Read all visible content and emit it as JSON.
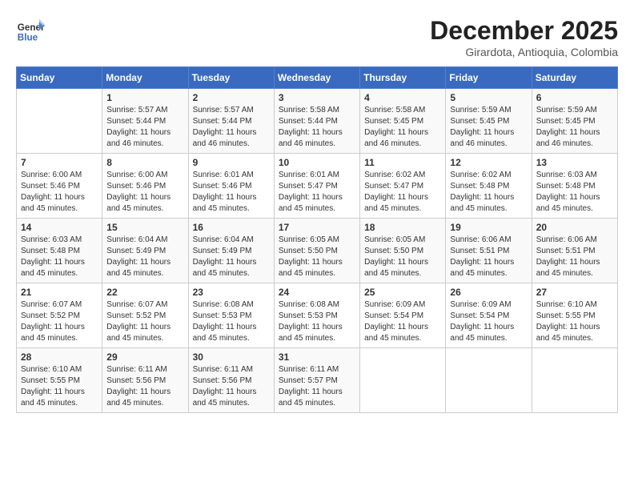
{
  "header": {
    "logo_line1": "General",
    "logo_line2": "Blue",
    "month": "December 2025",
    "location": "Girardota, Antioquia, Colombia"
  },
  "days_of_week": [
    "Sunday",
    "Monday",
    "Tuesday",
    "Wednesday",
    "Thursday",
    "Friday",
    "Saturday"
  ],
  "weeks": [
    [
      {
        "day": "",
        "sunrise": "",
        "sunset": "",
        "daylight": ""
      },
      {
        "day": "1",
        "sunrise": "Sunrise: 5:57 AM",
        "sunset": "Sunset: 5:44 PM",
        "daylight": "Daylight: 11 hours and 46 minutes."
      },
      {
        "day": "2",
        "sunrise": "Sunrise: 5:57 AM",
        "sunset": "Sunset: 5:44 PM",
        "daylight": "Daylight: 11 hours and 46 minutes."
      },
      {
        "day": "3",
        "sunrise": "Sunrise: 5:58 AM",
        "sunset": "Sunset: 5:44 PM",
        "daylight": "Daylight: 11 hours and 46 minutes."
      },
      {
        "day": "4",
        "sunrise": "Sunrise: 5:58 AM",
        "sunset": "Sunset: 5:45 PM",
        "daylight": "Daylight: 11 hours and 46 minutes."
      },
      {
        "day": "5",
        "sunrise": "Sunrise: 5:59 AM",
        "sunset": "Sunset: 5:45 PM",
        "daylight": "Daylight: 11 hours and 46 minutes."
      },
      {
        "day": "6",
        "sunrise": "Sunrise: 5:59 AM",
        "sunset": "Sunset: 5:45 PM",
        "daylight": "Daylight: 11 hours and 46 minutes."
      }
    ],
    [
      {
        "day": "7",
        "sunrise": "Sunrise: 6:00 AM",
        "sunset": "Sunset: 5:46 PM",
        "daylight": "Daylight: 11 hours and 45 minutes."
      },
      {
        "day": "8",
        "sunrise": "Sunrise: 6:00 AM",
        "sunset": "Sunset: 5:46 PM",
        "daylight": "Daylight: 11 hours and 45 minutes."
      },
      {
        "day": "9",
        "sunrise": "Sunrise: 6:01 AM",
        "sunset": "Sunset: 5:46 PM",
        "daylight": "Daylight: 11 hours and 45 minutes."
      },
      {
        "day": "10",
        "sunrise": "Sunrise: 6:01 AM",
        "sunset": "Sunset: 5:47 PM",
        "daylight": "Daylight: 11 hours and 45 minutes."
      },
      {
        "day": "11",
        "sunrise": "Sunrise: 6:02 AM",
        "sunset": "Sunset: 5:47 PM",
        "daylight": "Daylight: 11 hours and 45 minutes."
      },
      {
        "day": "12",
        "sunrise": "Sunrise: 6:02 AM",
        "sunset": "Sunset: 5:48 PM",
        "daylight": "Daylight: 11 hours and 45 minutes."
      },
      {
        "day": "13",
        "sunrise": "Sunrise: 6:03 AM",
        "sunset": "Sunset: 5:48 PM",
        "daylight": "Daylight: 11 hours and 45 minutes."
      }
    ],
    [
      {
        "day": "14",
        "sunrise": "Sunrise: 6:03 AM",
        "sunset": "Sunset: 5:48 PM",
        "daylight": "Daylight: 11 hours and 45 minutes."
      },
      {
        "day": "15",
        "sunrise": "Sunrise: 6:04 AM",
        "sunset": "Sunset: 5:49 PM",
        "daylight": "Daylight: 11 hours and 45 minutes."
      },
      {
        "day": "16",
        "sunrise": "Sunrise: 6:04 AM",
        "sunset": "Sunset: 5:49 PM",
        "daylight": "Daylight: 11 hours and 45 minutes."
      },
      {
        "day": "17",
        "sunrise": "Sunrise: 6:05 AM",
        "sunset": "Sunset: 5:50 PM",
        "daylight": "Daylight: 11 hours and 45 minutes."
      },
      {
        "day": "18",
        "sunrise": "Sunrise: 6:05 AM",
        "sunset": "Sunset: 5:50 PM",
        "daylight": "Daylight: 11 hours and 45 minutes."
      },
      {
        "day": "19",
        "sunrise": "Sunrise: 6:06 AM",
        "sunset": "Sunset: 5:51 PM",
        "daylight": "Daylight: 11 hours and 45 minutes."
      },
      {
        "day": "20",
        "sunrise": "Sunrise: 6:06 AM",
        "sunset": "Sunset: 5:51 PM",
        "daylight": "Daylight: 11 hours and 45 minutes."
      }
    ],
    [
      {
        "day": "21",
        "sunrise": "Sunrise: 6:07 AM",
        "sunset": "Sunset: 5:52 PM",
        "daylight": "Daylight: 11 hours and 45 minutes."
      },
      {
        "day": "22",
        "sunrise": "Sunrise: 6:07 AM",
        "sunset": "Sunset: 5:52 PM",
        "daylight": "Daylight: 11 hours and 45 minutes."
      },
      {
        "day": "23",
        "sunrise": "Sunrise: 6:08 AM",
        "sunset": "Sunset: 5:53 PM",
        "daylight": "Daylight: 11 hours and 45 minutes."
      },
      {
        "day": "24",
        "sunrise": "Sunrise: 6:08 AM",
        "sunset": "Sunset: 5:53 PM",
        "daylight": "Daylight: 11 hours and 45 minutes."
      },
      {
        "day": "25",
        "sunrise": "Sunrise: 6:09 AM",
        "sunset": "Sunset: 5:54 PM",
        "daylight": "Daylight: 11 hours and 45 minutes."
      },
      {
        "day": "26",
        "sunrise": "Sunrise: 6:09 AM",
        "sunset": "Sunset: 5:54 PM",
        "daylight": "Daylight: 11 hours and 45 minutes."
      },
      {
        "day": "27",
        "sunrise": "Sunrise: 6:10 AM",
        "sunset": "Sunset: 5:55 PM",
        "daylight": "Daylight: 11 hours and 45 minutes."
      }
    ],
    [
      {
        "day": "28",
        "sunrise": "Sunrise: 6:10 AM",
        "sunset": "Sunset: 5:55 PM",
        "daylight": "Daylight: 11 hours and 45 minutes."
      },
      {
        "day": "29",
        "sunrise": "Sunrise: 6:11 AM",
        "sunset": "Sunset: 5:56 PM",
        "daylight": "Daylight: 11 hours and 45 minutes."
      },
      {
        "day": "30",
        "sunrise": "Sunrise: 6:11 AM",
        "sunset": "Sunset: 5:56 PM",
        "daylight": "Daylight: 11 hours and 45 minutes."
      },
      {
        "day": "31",
        "sunrise": "Sunrise: 6:11 AM",
        "sunset": "Sunset: 5:57 PM",
        "daylight": "Daylight: 11 hours and 45 minutes."
      },
      {
        "day": "",
        "sunrise": "",
        "sunset": "",
        "daylight": ""
      },
      {
        "day": "",
        "sunrise": "",
        "sunset": "",
        "daylight": ""
      },
      {
        "day": "",
        "sunrise": "",
        "sunset": "",
        "daylight": ""
      }
    ]
  ]
}
